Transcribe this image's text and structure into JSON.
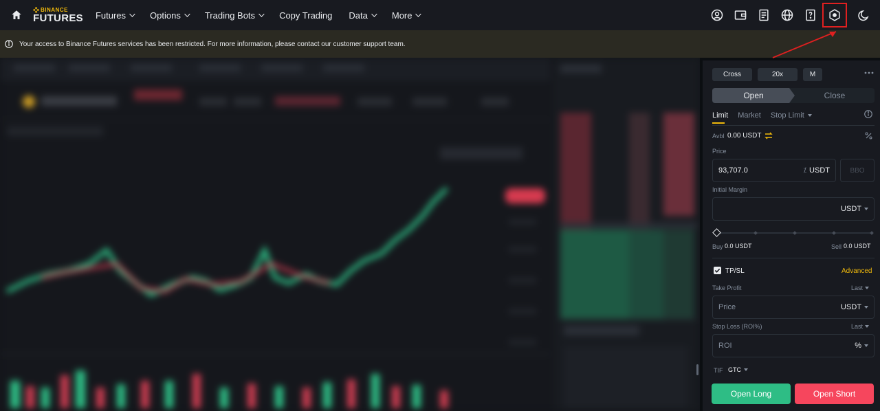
{
  "brand": {
    "line1": "BINANCE",
    "line2": "FUTURES"
  },
  "nav": [
    {
      "label": "Futures",
      "has_caret": true
    },
    {
      "label": "Options",
      "has_caret": true
    },
    {
      "label": "Trading Bots",
      "has_caret": true
    },
    {
      "label": "Copy Trading",
      "has_caret": false
    },
    {
      "label": "Data",
      "has_caret": true
    },
    {
      "label": "More",
      "has_caret": true
    }
  ],
  "nav_icons": [
    "user-icon",
    "wallet-icon",
    "orders-icon",
    "globe-icon",
    "help-icon",
    "settings-icon",
    "theme-moon-icon"
  ],
  "banner": {
    "text": "Your access to Binance Futures services has been restricted. For more information, please contact our customer support team."
  },
  "panel": {
    "margin_mode": "Cross",
    "leverage": "20x",
    "asset_mode": "M",
    "open_tab": "Open",
    "close_tab": "Close",
    "order_types": [
      "Limit",
      "Market",
      "Stop Limit"
    ],
    "avbl_label": "Avbl",
    "avbl_value": "0.00 USDT",
    "price_label": "Price",
    "price_value": "93,707.0",
    "price_unit": "USDT",
    "bbo_label": "BBO",
    "initial_margin_label": "Initial Margin",
    "initial_margin_unit": "USDT",
    "buy_label": "Buy",
    "buy_value": "0.0 USDT",
    "sell_label": "Sell",
    "sell_value": "0.0 USDT",
    "tpsl_label": "TP/SL",
    "advanced_label": "Advanced",
    "take_profit_label": "Take Profit",
    "take_profit_mode": "Last",
    "tp_placeholder": "Price",
    "tp_unit": "USDT",
    "stop_loss_label": "Stop Loss (ROI%)",
    "stop_loss_mode": "Last",
    "sl_placeholder": "ROI",
    "sl_unit": "%",
    "tif_label": "TIF",
    "tif_value": "GTC",
    "open_long": "Open Long",
    "open_short": "Open Short"
  },
  "colors": {
    "accent": "#f0b90b",
    "long": "#2ebd85",
    "short": "#f6465d",
    "bg": "#0b0e11",
    "panel": "#181a20",
    "highlight": "#e02020"
  }
}
